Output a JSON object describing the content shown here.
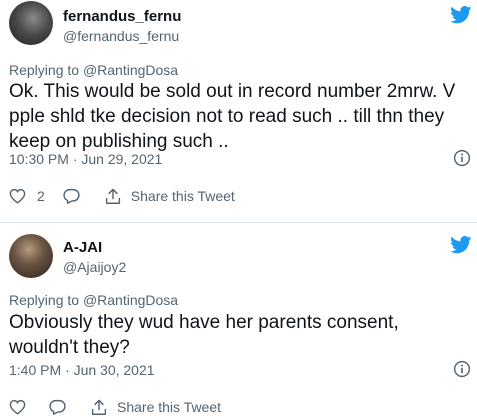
{
  "tweets": [
    {
      "display_name": "fernandus_fernu",
      "handle": "@fernandus_fernu",
      "replying_to_prefix": "Replying to ",
      "replying_to_mention": "@RantingDosa",
      "text": "Ok. This would be sold out in record number 2mrw. V pple shld tke decision not to read such .. till thn they keep on publishing such ..",
      "timestamp": "10:30 PM · Jun 29, 2021",
      "like_count": "2",
      "share_label": "Share this Tweet"
    },
    {
      "display_name": "A-JAI",
      "handle": "@Ajaijoy2",
      "replying_to_prefix": "Replying to ",
      "replying_to_mention": "@RantingDosa",
      "text": "Obviously they wud have her parents consent, wouldn't they?",
      "timestamp": "1:40 PM · Jun 30, 2021",
      "like_count": "",
      "share_label": "Share this Tweet"
    }
  ],
  "colors": {
    "twitter_blue": "#1d9bf0",
    "secondary_text": "#536471",
    "primary_text": "#0f1419",
    "divider": "#e1e8ed"
  },
  "icons": [
    "twitter-bird-icon",
    "info-icon",
    "heart-icon",
    "reply-icon",
    "share-icon"
  ]
}
